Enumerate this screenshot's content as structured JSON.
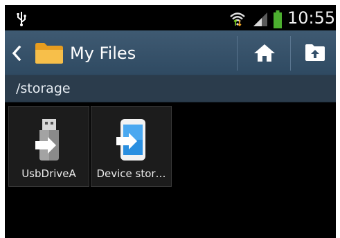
{
  "status_bar": {
    "time": "10:55",
    "icons": [
      "usb-icon",
      "wifi-icon",
      "signal-icon",
      "battery-icon"
    ],
    "battery_color": "#4caf2f"
  },
  "action_bar": {
    "title": "My Files",
    "icons": [
      "back-icon",
      "folder-icon",
      "home-icon",
      "up-folder-icon"
    ],
    "background": "#3a546b",
    "folder_color": "#f5b53a"
  },
  "path_bar": {
    "path": "/storage"
  },
  "items": [
    {
      "label": "UsbDriveA",
      "icon": "usb-drive-icon"
    },
    {
      "label": "Device stor…",
      "icon": "device-storage-icon"
    }
  ]
}
